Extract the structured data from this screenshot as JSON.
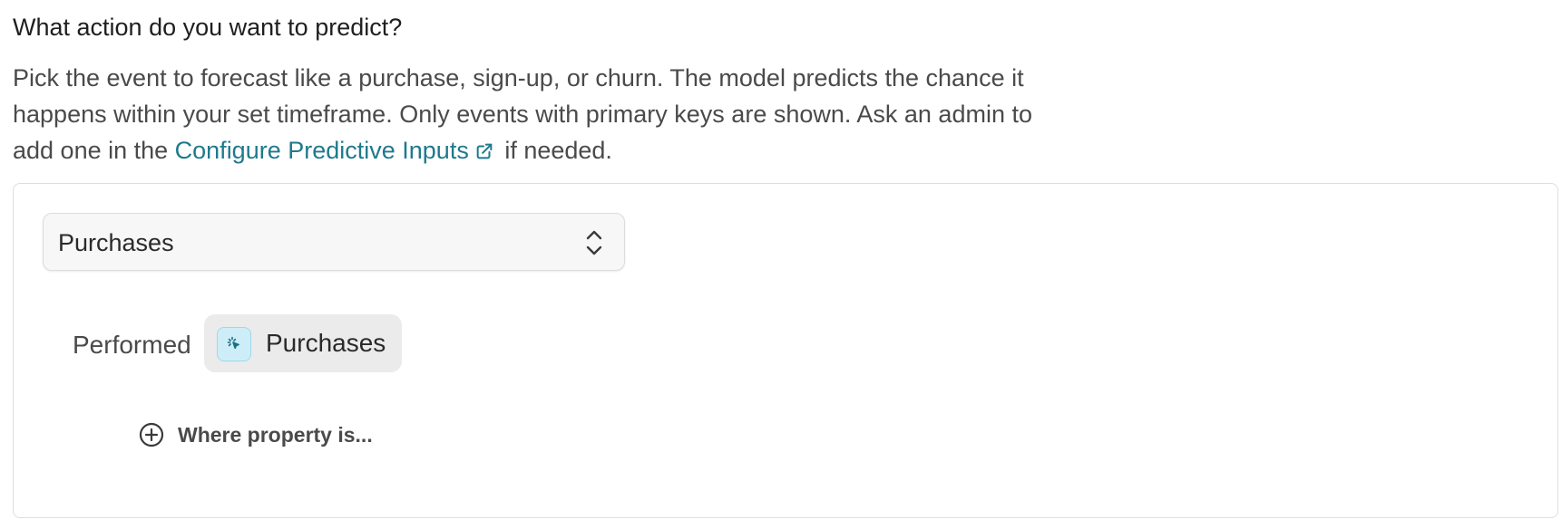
{
  "question": {
    "title": "What action do you want to predict?"
  },
  "description": {
    "line1": "Pick the event to forecast like a purchase, sign-up, or churn. The model predicts the chance it",
    "line2": "happens within your set timeframe. Only events with primary keys are shown. Ask an admin to",
    "line3_prefix": "add one in the ",
    "link_text": "Configure Predictive Inputs",
    "link_icon": "external-link-icon",
    "line3_suffix": " if needed."
  },
  "event_select": {
    "selected": "Purchases",
    "icon": "chevron-up-down-icon"
  },
  "condition": {
    "performed_label": "Performed",
    "event_chip": {
      "label": "Purchases",
      "icon": "cursor-click-icon",
      "icon_bg": "#cdeef8"
    }
  },
  "add_filter": {
    "label": "Where property is...",
    "icon": "plus-circle-icon"
  },
  "colors": {
    "link": "#1f7a8c",
    "chip_bg": "#ebebeb",
    "panel_border": "#dedede"
  }
}
